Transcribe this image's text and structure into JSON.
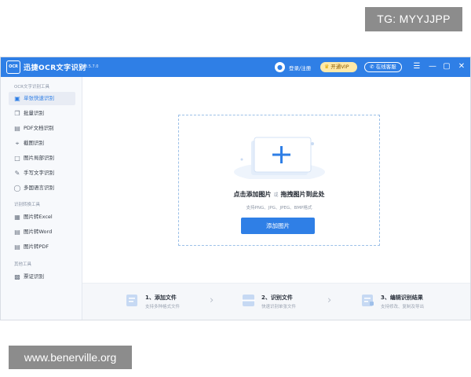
{
  "watermarks": {
    "top": "TG: MYYJJPP",
    "bottom": "www.benerville.org"
  },
  "titlebar": {
    "logo_text": "OCR",
    "app_name": "迅捷OCR文字识别",
    "version": "v8.5.7.0",
    "login": "登录/注册",
    "vip": "开通VIP",
    "consult": "在线客服",
    "icons": [
      "user-avatar-icon",
      "crown-icon",
      "headset-icon",
      "menu-icon",
      "minimize-icon",
      "maximize-icon",
      "close-icon"
    ]
  },
  "sidebar": {
    "sections": [
      {
        "title": "OCR文字识别工具",
        "items": [
          {
            "label": "单张快速识别",
            "icon": "single-image-icon",
            "active": true
          },
          {
            "label": "批量识别",
            "icon": "batch-icon"
          },
          {
            "label": "PDF文档识别",
            "icon": "pdf-icon"
          },
          {
            "label": "截图识别",
            "icon": "crop-icon"
          },
          {
            "label": "图片局部识别",
            "icon": "partial-select-icon"
          },
          {
            "label": "手写文字识别",
            "icon": "handwriting-icon"
          },
          {
            "label": "多国语言识别",
            "icon": "globe-icon"
          }
        ]
      },
      {
        "title": "识别转换工具",
        "items": [
          {
            "label": "图片转Excel",
            "icon": "excel-icon"
          },
          {
            "label": "图片转Word",
            "icon": "word-icon"
          },
          {
            "label": "图片转PDF",
            "icon": "pdf-convert-icon"
          }
        ]
      },
      {
        "title": "其他工具",
        "items": [
          {
            "label": "票证识别",
            "icon": "ticket-icon"
          }
        ]
      }
    ]
  },
  "main": {
    "drop_title_a": "点击添加图片",
    "drop_or": "或",
    "drop_title_b": "拖拽图片到此处",
    "formats": "支持PNG、JPG、JPEG、BMP格式",
    "add_button": "添加图片"
  },
  "steps": [
    {
      "title": "1、添加文件",
      "desc": "支持多种格式文件"
    },
    {
      "title": "2、识别文件",
      "desc": "快速识别单张文件"
    },
    {
      "title": "3、编辑识别结果",
      "desc": "支持修改、复制及导出"
    }
  ],
  "colors": {
    "accent": "#2f7fe6",
    "vip": "#ffe9a8",
    "sidebar_bg": "#f7f9fc",
    "dash": "#9cc0e8"
  }
}
